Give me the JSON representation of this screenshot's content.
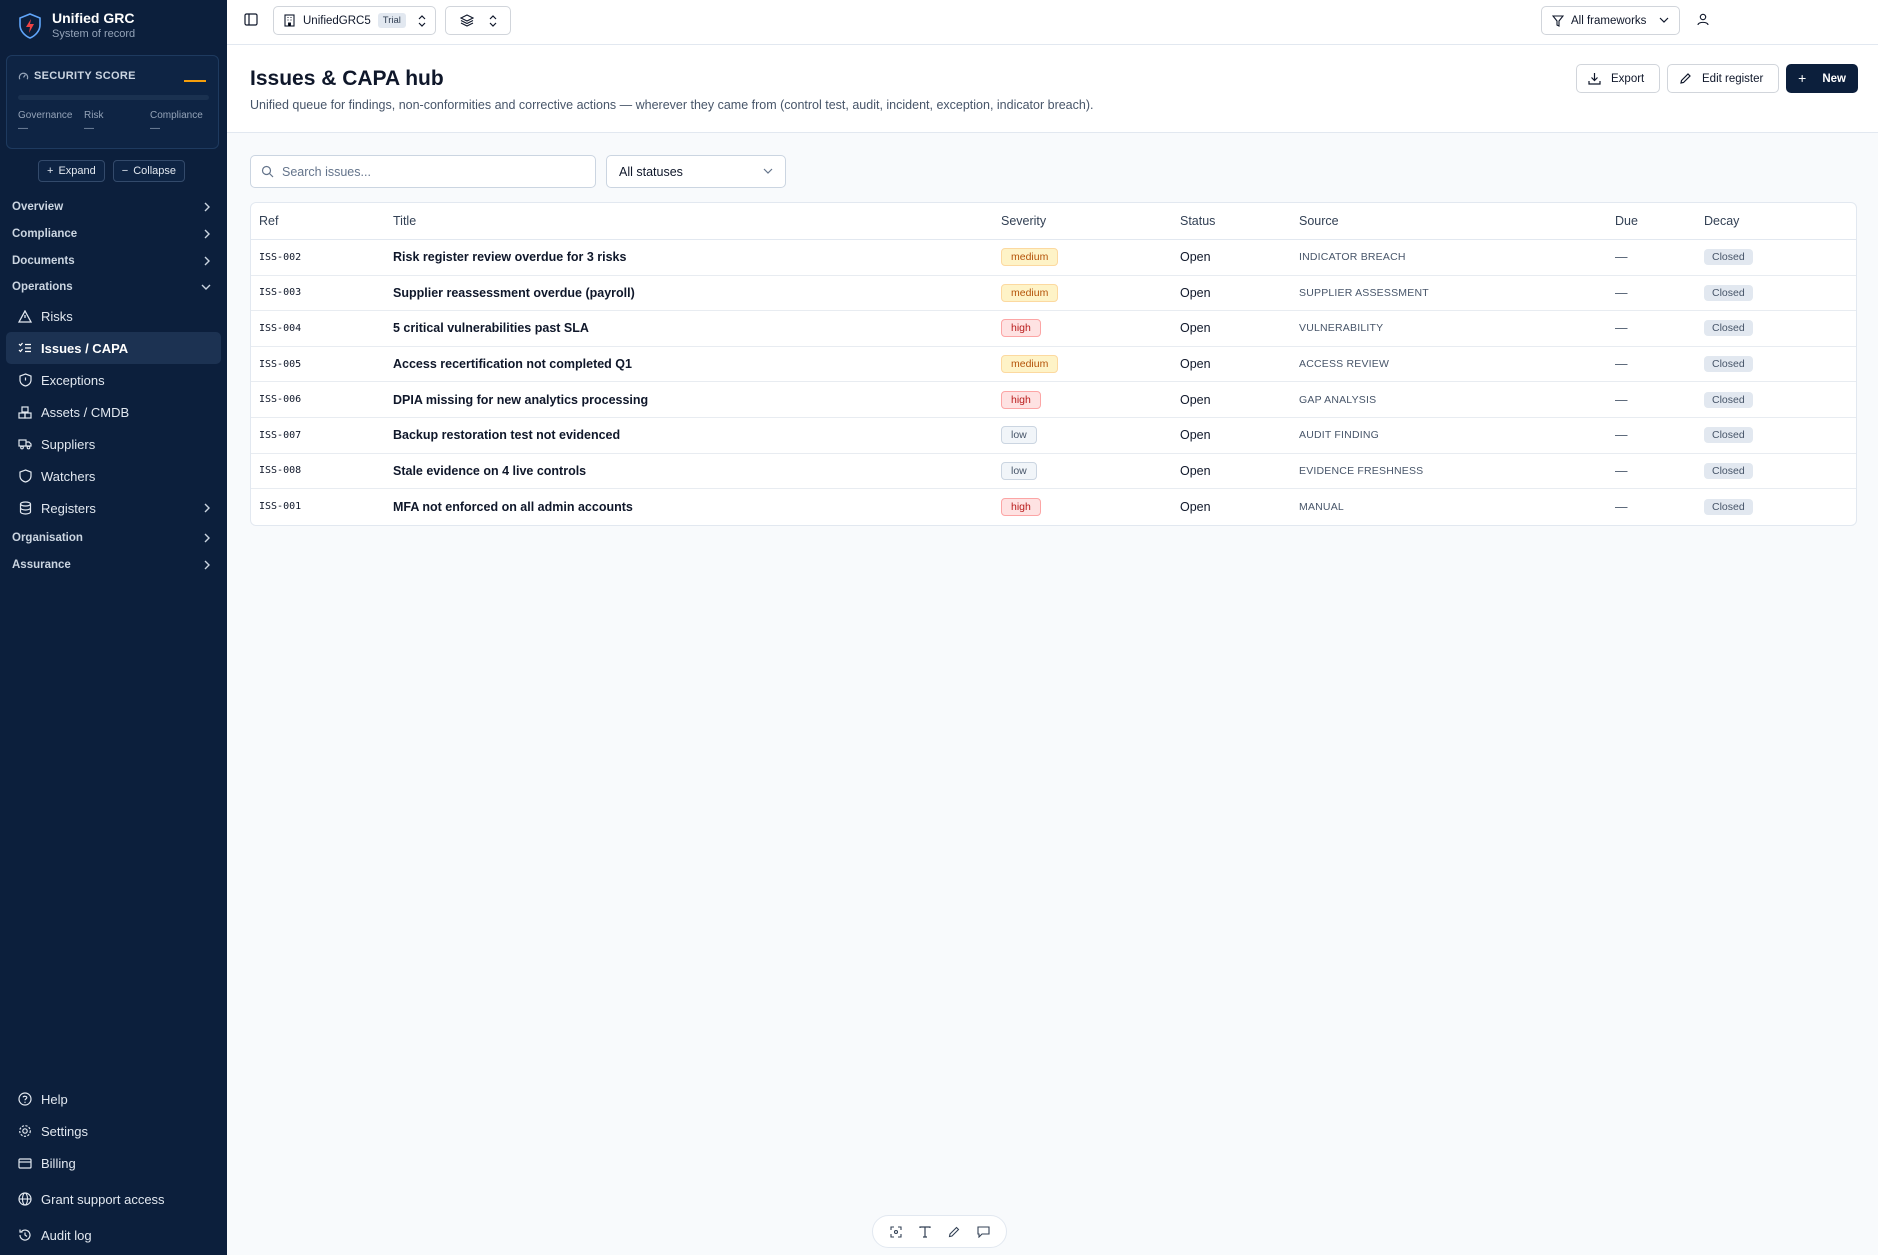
{
  "brand": {
    "title": "Unified GRC",
    "subtitle": "System of record"
  },
  "score": {
    "label": "SECURITY SCORE",
    "cols": [
      {
        "name": "Governance",
        "value": "—"
      },
      {
        "name": "Risk",
        "value": "—"
      },
      {
        "name": "Compliance",
        "value": "—"
      }
    ],
    "accent": "#f59e0b"
  },
  "tree_controls": {
    "expand": "Expand",
    "collapse": "Collapse"
  },
  "nav": {
    "overview": "Overview",
    "compliance": "Compliance",
    "documents": "Documents",
    "operations": "Operations",
    "operations_items": [
      "Risks",
      "Issues / CAPA",
      "Exceptions",
      "Assets / CMDB",
      "Suppliers",
      "Watchers",
      "Registers"
    ],
    "organisation": "Organisation",
    "assurance": "Assurance"
  },
  "bottom_nav": [
    "Help",
    "Settings",
    "Billing",
    "Grant support access",
    "Audit log"
  ],
  "topbar": {
    "org": "UnifiedGRC5",
    "org_badge": "Trial",
    "framework_filter": "All frameworks"
  },
  "header": {
    "title": "Issues & CAPA hub",
    "description": "Unified queue for findings, non-conformities and corrective actions — wherever they came from (control test, audit, incident, exception, indicator breach).",
    "export": "Export",
    "edit_register": "Edit register",
    "new": "New"
  },
  "filters": {
    "search_placeholder": "Search issues...",
    "status": "All statuses"
  },
  "table": {
    "columns": {
      "ref": "Ref",
      "title": "Title",
      "severity": "Severity",
      "status": "Status",
      "source": "Source",
      "due": "Due",
      "decay": "Decay"
    },
    "rows": [
      {
        "ref": "ISS-002",
        "title": "Risk register review overdue for 3 risks",
        "severity": "medium",
        "status": "Open",
        "source": "INDICATOR BREACH",
        "due": "—",
        "decay": "Closed"
      },
      {
        "ref": "ISS-003",
        "title": "Supplier reassessment overdue (payroll)",
        "severity": "medium",
        "status": "Open",
        "source": "SUPPLIER ASSESSMENT",
        "due": "—",
        "decay": "Closed"
      },
      {
        "ref": "ISS-004",
        "title": "5 critical vulnerabilities past SLA",
        "severity": "high",
        "status": "Open",
        "source": "VULNERABILITY",
        "due": "—",
        "decay": "Closed"
      },
      {
        "ref": "ISS-005",
        "title": "Access recertification not completed Q1",
        "severity": "medium",
        "status": "Open",
        "source": "ACCESS REVIEW",
        "due": "—",
        "decay": "Closed"
      },
      {
        "ref": "ISS-006",
        "title": "DPIA missing for new analytics processing",
        "severity": "high",
        "status": "Open",
        "source": "GAP ANALYSIS",
        "due": "—",
        "decay": "Closed"
      },
      {
        "ref": "ISS-007",
        "title": "Backup restoration test not evidenced",
        "severity": "low",
        "status": "Open",
        "source": "AUDIT FINDING",
        "due": "—",
        "decay": "Closed"
      },
      {
        "ref": "ISS-008",
        "title": "Stale evidence on 4 live controls",
        "severity": "low",
        "status": "Open",
        "source": "EVIDENCE FRESHNESS",
        "due": "—",
        "decay": "Closed"
      },
      {
        "ref": "ISS-001",
        "title": "MFA not enforced on all admin accounts",
        "severity": "high",
        "status": "Open",
        "source": "MANUAL",
        "due": "—",
        "decay": "Closed"
      }
    ]
  },
  "colors": {
    "sidebar_bg": "#0c1f3c",
    "primary": "#0c1f3c",
    "medium": "#b45309",
    "high": "#b91c1c",
    "low": "#475569"
  }
}
